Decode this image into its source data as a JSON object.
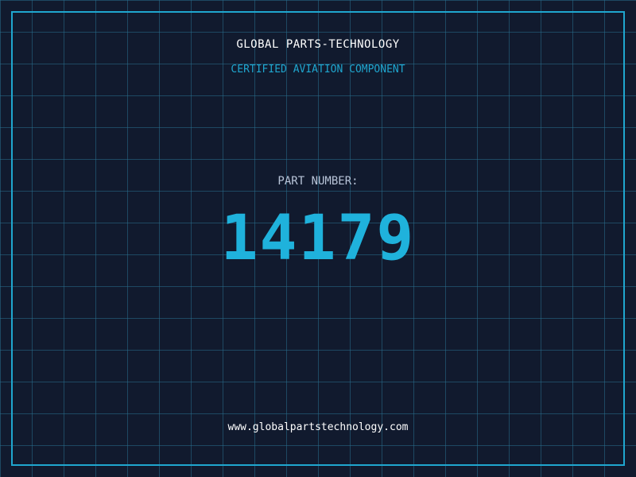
{
  "header": {
    "company_name": "GLOBAL PARTS-TECHNOLOGY",
    "subtitle": "CERTIFIED AVIATION COMPONENT"
  },
  "part": {
    "label": "PART NUMBER:",
    "number": "14179"
  },
  "footer": {
    "url": "www.globalpartstechnology.com"
  },
  "colors": {
    "background": "#111a2e",
    "grid": "#286e8c",
    "accent": "#1fa6cf",
    "part_number": "#1fb2dc",
    "label": "#b8c4d8",
    "text": "#ffffff"
  }
}
